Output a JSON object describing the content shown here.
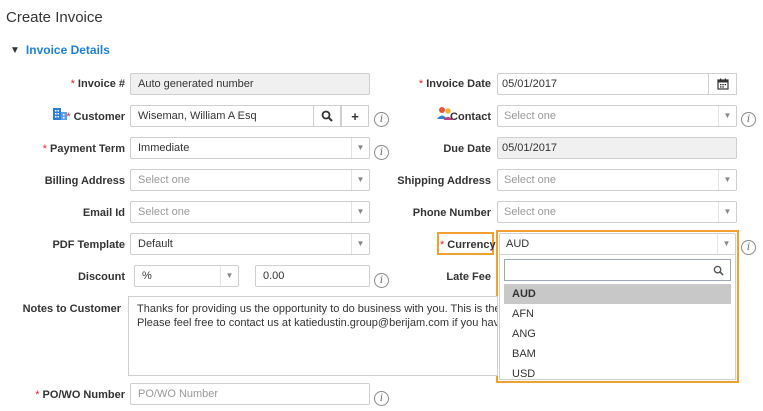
{
  "page": {
    "title": "Create Invoice",
    "section": "Invoice Details"
  },
  "left": {
    "invoice_no": {
      "label": "Invoice #",
      "value": "Auto generated number"
    },
    "customer": {
      "label": "Customer",
      "value": "Wiseman, William A Esq"
    },
    "payment_term": {
      "label": "Payment Term",
      "value": "Immediate"
    },
    "billing_address": {
      "label": "Billing Address",
      "placeholder": "Select one"
    },
    "email_id": {
      "label": "Email Id",
      "placeholder": "Select one"
    },
    "pdf_template": {
      "label": "PDF Template",
      "value": "Default"
    },
    "discount": {
      "label": "Discount",
      "type": "%",
      "value": "0.00"
    },
    "notes": {
      "label": "Notes to Customer",
      "line1": "Thanks for providing us the opportunity to do business with you. This is the invoice f",
      "line2": "Please feel free to contact us at katiedustin.group@berijam.com if you have any que"
    },
    "po_wo": {
      "label": "PO/WO Number",
      "placeholder": "PO/WO Number"
    }
  },
  "right": {
    "invoice_date": {
      "label": "Invoice Date",
      "value": "05/01/2017"
    },
    "contact": {
      "label": "Contact",
      "placeholder": "Select one"
    },
    "due_date": {
      "label": "Due Date",
      "value": "05/01/2017"
    },
    "shipping_address": {
      "label": "Shipping Address",
      "placeholder": "Select one"
    },
    "phone_number": {
      "label": "Phone Number",
      "placeholder": "Select one"
    },
    "currency": {
      "label": "Currency",
      "value": "AUD",
      "options": [
        "AUD",
        "AFN",
        "ANG",
        "BAM",
        "USD"
      ]
    },
    "late_fee": {
      "label": "Late Fee"
    }
  },
  "symbols": {
    "required": "*",
    "info": "i",
    "plus": "+",
    "caret": "▼",
    "chevron": "▼"
  },
  "colors": {
    "accent": "#1f7fd0",
    "required": "#d9262c",
    "highlight": "#f0a030"
  }
}
